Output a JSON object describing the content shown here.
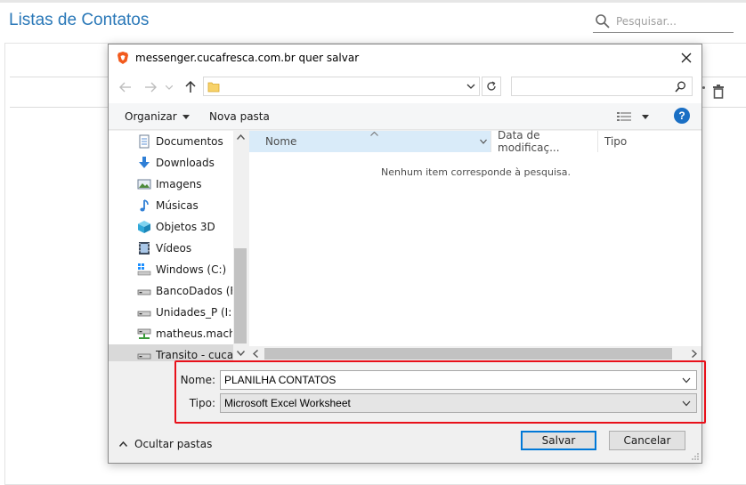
{
  "background": {
    "title": "Listas de Contatos",
    "search_placeholder": "Pesquisar..."
  },
  "dialog": {
    "title": "messenger.cucafresca.com.br quer salvar",
    "toolbar": {
      "organize": "Organizar",
      "new_folder": "Nova pasta",
      "help": "?"
    },
    "tree": [
      {
        "label": "Documentos",
        "icon": "documents-icon"
      },
      {
        "label": "Downloads",
        "icon": "downloads-icon"
      },
      {
        "label": "Imagens",
        "icon": "pictures-icon"
      },
      {
        "label": "Músicas",
        "icon": "music-icon"
      },
      {
        "label": "Objetos 3D",
        "icon": "objects-3d-icon"
      },
      {
        "label": "Vídeos",
        "icon": "videos-icon"
      },
      {
        "label": "Windows (C:)",
        "icon": "windows-drive-icon"
      },
      {
        "label": "BancoDados (F:)",
        "icon": "drive-icon"
      },
      {
        "label": "Unidades_P (I:)",
        "icon": "drive-icon"
      },
      {
        "label": "matheus.macha",
        "icon": "network-drive-icon"
      },
      {
        "label": "Transito - cuca i",
        "icon": "drive-icon"
      }
    ],
    "columns": {
      "name": "Nome",
      "date": "Data de modificaç...",
      "type": "Tipo"
    },
    "empty_message": "Nenhum item corresponde à pesquisa.",
    "form": {
      "name_label": "Nome:",
      "name_value": "PLANILHA CONTATOS",
      "type_label": "Tipo:",
      "type_value": "Microsoft Excel Worksheet"
    },
    "hide_folders": "Ocultar pastas",
    "save": "Salvar",
    "cancel": "Cancelar"
  },
  "colors": {
    "accent": "#2a78b8",
    "highlight": "#e8101a",
    "header_selected": "#d9ebf9",
    "primary_button_border": "#0078d7"
  }
}
